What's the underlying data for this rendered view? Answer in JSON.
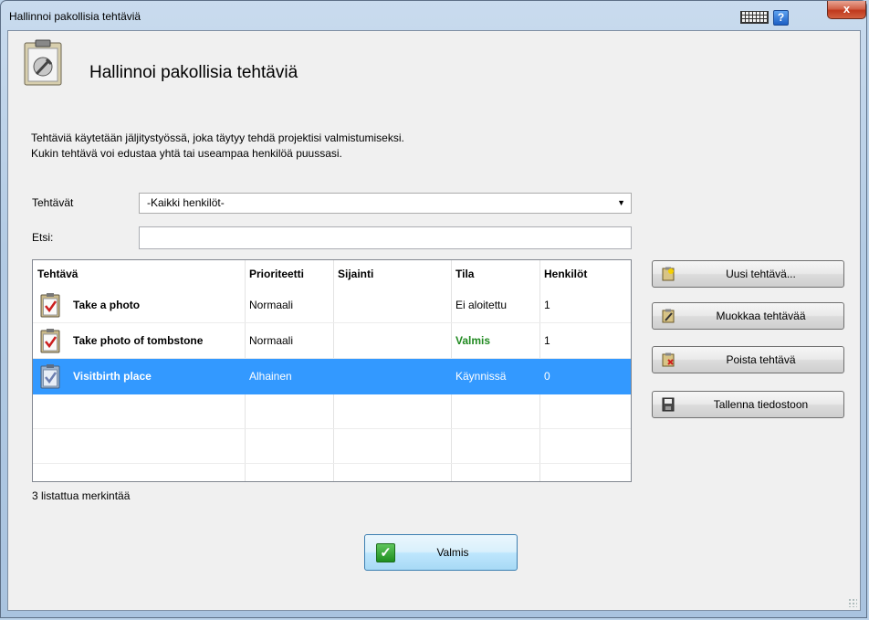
{
  "window": {
    "title": "Hallinnoi pakollisia tehtäviä",
    "help_glyph": "?",
    "close_glyph": "x"
  },
  "header": {
    "title": "Hallinnoi pakollisia tehtäviä",
    "icon": "clipboard-wrench-icon"
  },
  "description": {
    "line1": "Tehtäviä käytetään jäljitystyössä, joka täytyy tehdä projektisi valmistumiseksi.",
    "line2": "Kukin tehtävä voi edustaa yhtä tai useampaa henkilöä puussasi."
  },
  "filter": {
    "label": "Tehtävät",
    "selected": "-Kaikki henkilöt-"
  },
  "search": {
    "label": "Etsi:",
    "value": "",
    "placeholder": ""
  },
  "table": {
    "columns": [
      "Tehtävä",
      "Prioriteetti",
      "Sijainti",
      "Tila",
      "Henkilöt"
    ],
    "rows": [
      {
        "name": "Take a photo",
        "priority": "Normaali",
        "location": "",
        "status": "Ei aloitettu",
        "persons": "1",
        "selected": false
      },
      {
        "name": "Take photo of tombstone",
        "priority": "Normaali",
        "location": "",
        "status": "Valmis",
        "persons": "1",
        "selected": false
      },
      {
        "name": "Visitbirth place",
        "priority": "Alhainen",
        "location": "",
        "status": "Käynnissä",
        "persons": "0",
        "selected": true
      }
    ],
    "status_colors": {
      "done": "#218a21"
    },
    "selection_color": "#3399ff"
  },
  "count_text": "3 listattua merkintää",
  "actions": {
    "new": "Uusi tehtävä...",
    "edit": "Muokkaa tehtävää",
    "delete": "Poista tehtävä",
    "save": "Tallenna tiedostoon"
  },
  "done_button": {
    "label": "Valmis",
    "glyph": "✓"
  }
}
